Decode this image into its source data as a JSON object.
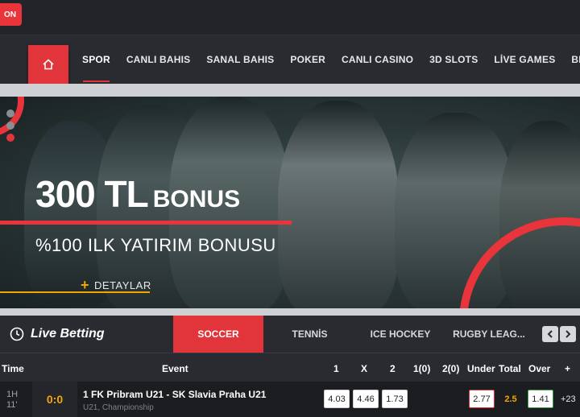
{
  "topbar": {
    "login_label": "ON"
  },
  "nav": {
    "home_icon": "home-icon",
    "items": [
      "SPOR",
      "CANLI BAHIS",
      "SANAL BAHIS",
      "POKER",
      "CANLI CASINO",
      "3D SLOTS",
      "LİVE GAMES",
      "BINGO"
    ],
    "active": "SPOR"
  },
  "banner": {
    "amount": "300 TL",
    "bonus_word": "BONUS",
    "subtitle": "%100 ILK YATIRIM BONUSU",
    "details_label": "DETAYLAR",
    "slide_count": 3,
    "active_slide": 3
  },
  "live": {
    "title": "Live Betting",
    "tabs": [
      "SOCCER",
      "TENNİS",
      "ICE HOCKEY",
      "RUGBY LEAG..."
    ],
    "active_tab": "SOCCER",
    "columns": {
      "time": "Time",
      "event": "Event",
      "c1": "1",
      "cx": "X",
      "c2": "2",
      "c10": "1(0)",
      "c20": "2(0)",
      "under": "Under",
      "total": "Total",
      "over": "Over",
      "plus": "+"
    },
    "rows": [
      {
        "period": "1H",
        "minute": "11'",
        "score": "0:0",
        "event": "1 FK Pribram U21 - SK Slavia Praha U21",
        "league": "U21, Championship",
        "odd1": "4.03",
        "oddx": "4.46",
        "odd2": "1.73",
        "under": "2.77",
        "total": "2.5",
        "over": "1.41",
        "more": "+23"
      }
    ]
  },
  "colors": {
    "accent": "#e2343b",
    "gold": "#f0a800",
    "over_green": "#3aa04a",
    "bg_dark": "#2a2b31"
  }
}
